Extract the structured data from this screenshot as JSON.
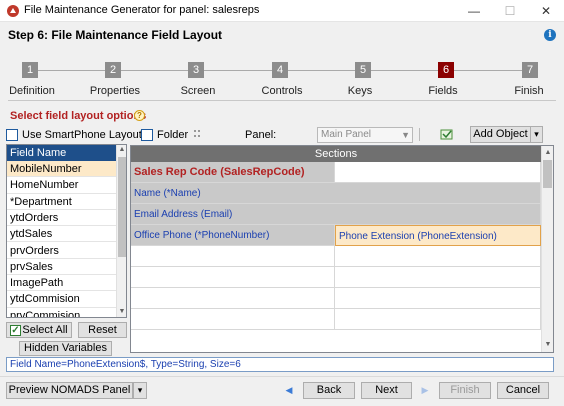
{
  "window": {
    "title": "File Maintenance Generator for panel: salesreps",
    "minimize": "—",
    "maximize": "☐",
    "close": "✕"
  },
  "header": {
    "step_title": "Step 6: File Maintenance Field Layout",
    "info_icon": "i"
  },
  "steps": [
    {
      "num": "1",
      "label": "Definition"
    },
    {
      "num": "2",
      "label": "Properties"
    },
    {
      "num": "3",
      "label": "Screen"
    },
    {
      "num": "4",
      "label": "Controls"
    },
    {
      "num": "5",
      "label": "Keys"
    },
    {
      "num": "6",
      "label": "Fields",
      "active": true
    },
    {
      "num": "7",
      "label": "Finish"
    }
  ],
  "section": {
    "title": "Select field layout options",
    "help_icon": "?"
  },
  "toolbar": {
    "smartphone_label": "Use SmartPhone Layout",
    "folder_label": "Folder",
    "panel_label": "Panel:",
    "panel_value": "Main Panel",
    "add_object_label": "Add Object",
    "dropdown_arrow": "▾"
  },
  "field_list": {
    "header": "Field Name",
    "items": [
      "MobileNumber",
      "HomeNumber",
      "*Department",
      "ytdOrders",
      "ytdSales",
      "prvOrders",
      "prvSales",
      "ImagePath",
      "ytdCommision",
      "prvCommision"
    ]
  },
  "buttons": {
    "select_all": "Select All",
    "reset": "Reset",
    "hidden_variables": "Hidden Variables",
    "preview": "Preview NOMADS Panel",
    "back": "Back",
    "next": "Next",
    "finish": "Finish",
    "cancel": "Cancel"
  },
  "grid": {
    "header": "Sections",
    "rows": [
      [
        "Sales Rep Code (SalesRepCode)",
        ""
      ],
      [
        "Name (*Name)",
        ""
      ],
      [
        "Email Address (Email)",
        ""
      ],
      [
        "Office Phone (*PhoneNumber)",
        "Phone Extension (PhoneExtension)"
      ],
      [
        "",
        ""
      ],
      [
        "",
        ""
      ],
      [
        "",
        ""
      ],
      [
        "",
        ""
      ]
    ]
  },
  "status": "Field Name=PhoneExtension$,  Type=String,  Size=6",
  "colors": {
    "active_step": "#8b0000",
    "step": "#8c8c8c",
    "section_title": "#b22222",
    "link_text": "#1a3fb0",
    "field_header": "#1e4f8a",
    "selected_row": "#fde9c8"
  }
}
